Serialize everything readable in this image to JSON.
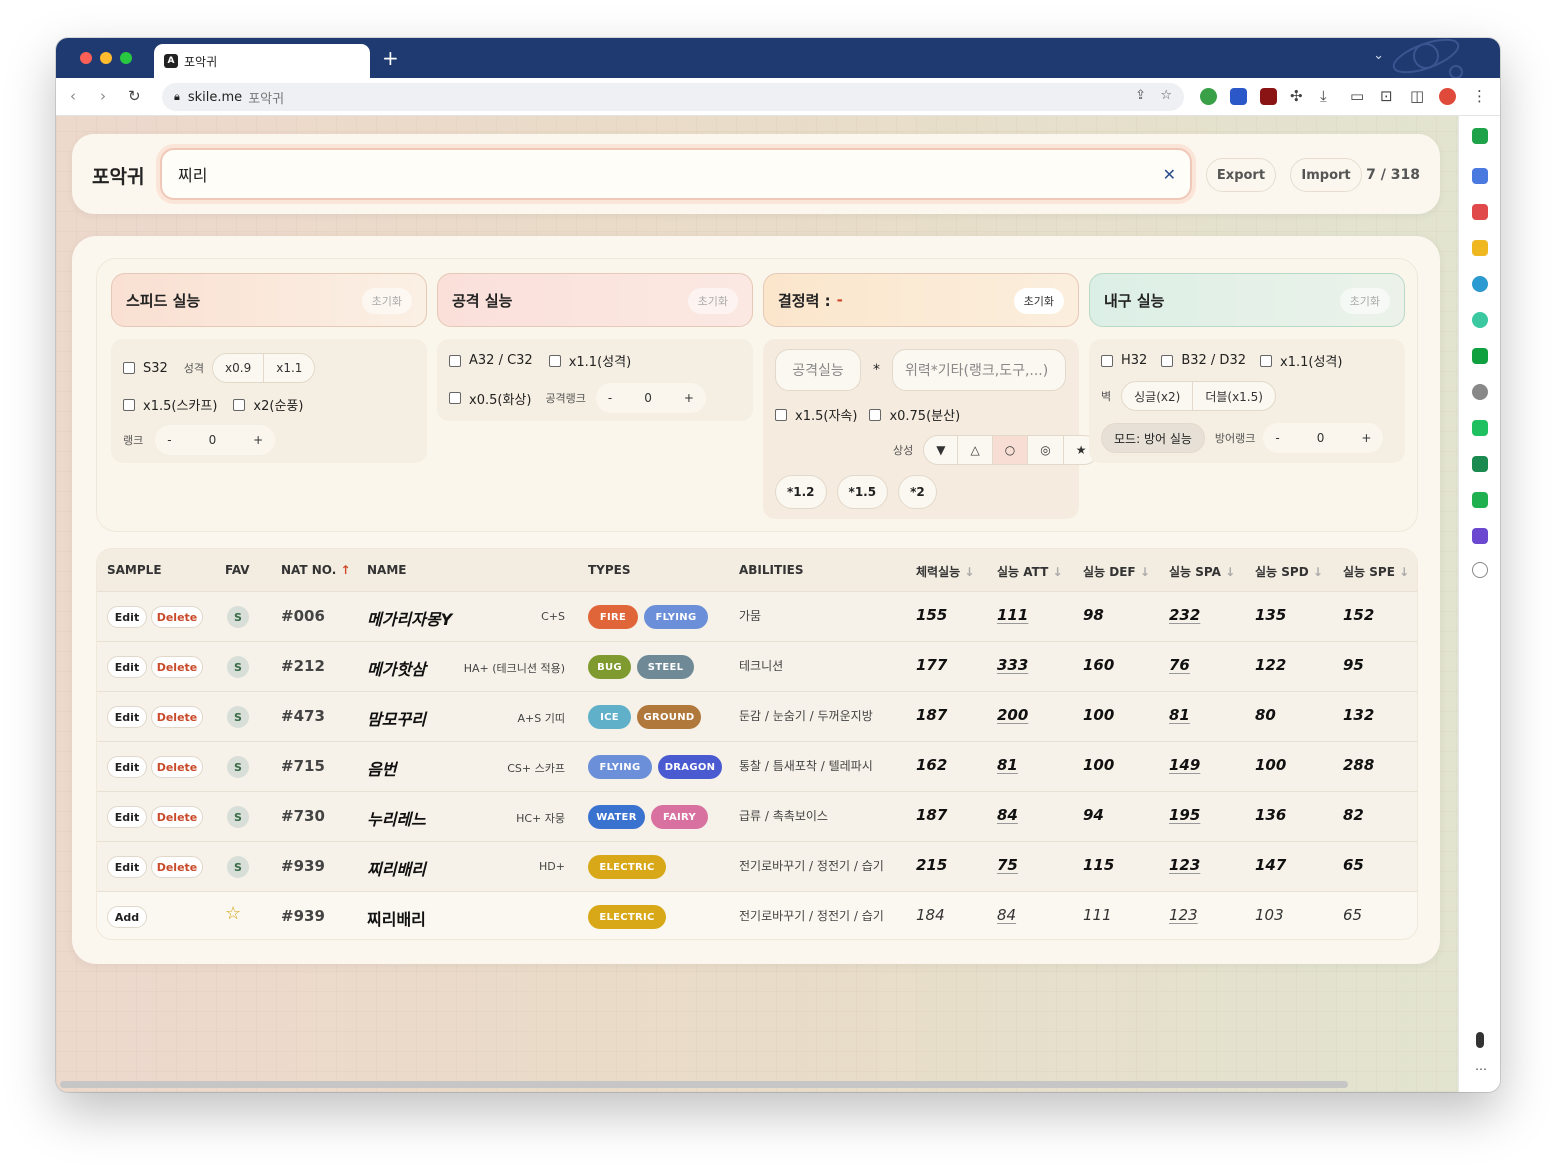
{
  "browser": {
    "tab_title": "포악귀",
    "url_host": "skile.me",
    "url_path": "포악귀"
  },
  "app": {
    "title": "포악귀",
    "search_value": "찌리",
    "export_label": "Export",
    "import_label": "Import",
    "count": "7 / 318"
  },
  "filters": {
    "speed": {
      "title": "스피드 실능",
      "reset": "초기화",
      "s32": "S32",
      "nature_label": "성격",
      "nature_opts": [
        "x0.9",
        "x1.1"
      ],
      "scarf": "x1.5(스카프)",
      "tailwind": "x2(순풍)",
      "rank_label": "랭크",
      "rank_minus": "-",
      "rank_value": "0",
      "rank_plus": "+"
    },
    "attack": {
      "title": "공격 실능",
      "reset": "초기화",
      "a32": "A32 / C32",
      "nature": "x1.1(성격)",
      "burn": "x0.5(화상)",
      "rank_label": "공격랭크",
      "rank_minus": "-",
      "rank_value": "0",
      "rank_plus": "+"
    },
    "decisive": {
      "title": "결정력 :",
      "title_value": "-",
      "reset": "초기화",
      "atk_placeholder": "공격실능",
      "times": "*",
      "power_placeholder": "위력*기타(랭크,도구,...)",
      "stab": "x1.5(자속)",
      "spread": "x0.75(분산)",
      "effect_label": "상성",
      "effect_opts": [
        "▼",
        "△",
        "○",
        "◎",
        "★"
      ],
      "mults": [
        "*1.2",
        "*1.5",
        "*2"
      ]
    },
    "defense": {
      "title": "내구 실능",
      "reset": "초기화",
      "h32": "H32",
      "b32": "B32 / D32",
      "nature": "x1.1(성격)",
      "wall_label": "벽",
      "wall_opts": [
        "싱글(x2)",
        "더블(x1.5)"
      ],
      "mode": "모드: 방어 실능",
      "rank_label": "방어랭크",
      "rank_minus": "-",
      "rank_value": "0",
      "rank_plus": "+"
    }
  },
  "table": {
    "headers": {
      "sample": "SAMPLE",
      "fav": "FAV",
      "natno": "NAT NO.",
      "natno_sort": "↑",
      "name": "NAME",
      "types": "TYPES",
      "abilities": "ABILITIES",
      "hp": "체력실능",
      "att": "실능 ATT",
      "def": "실능 DEF",
      "spa": "실능 SPA",
      "spd": "실능 SPD",
      "spe": "실능 SPE",
      "sort_down": "↓"
    },
    "edit_label": "Edit",
    "delete_label": "Delete",
    "add_label": "Add",
    "sample_badge": "S",
    "fav_star": "☆",
    "rows": [
      {
        "no": "#006",
        "name": "메가리자몽Y",
        "note": "C+S",
        "types": [
          "FIRE",
          "FLYING"
        ],
        "abilities": "가뭄",
        "hp": "155",
        "att": "111",
        "def": "98",
        "spa": "232",
        "spd": "135",
        "spe": "152"
      },
      {
        "no": "#212",
        "name": "메가핫삼",
        "note": "HA+ (테크니션 적용)",
        "types": [
          "BUG",
          "STEEL"
        ],
        "abilities": "테크니션",
        "hp": "177",
        "att": "333",
        "def": "160",
        "spa": "76",
        "spd": "122",
        "spe": "95"
      },
      {
        "no": "#473",
        "name": "맘모꾸리",
        "note": "A+S 기띠",
        "types": [
          "ICE",
          "GROUND"
        ],
        "abilities": "둔감 / 눈숨기 / 두꺼운지방",
        "hp": "187",
        "att": "200",
        "def": "100",
        "spa": "81",
        "spd": "80",
        "spe": "132"
      },
      {
        "no": "#715",
        "name": "음번",
        "note": "CS+ 스카프",
        "types": [
          "FLYING",
          "DRAGON"
        ],
        "abilities": "통찰 / 틈새포착 / 텔레파시",
        "hp": "162",
        "att": "81",
        "def": "100",
        "spa": "149",
        "spd": "100",
        "spe": "288"
      },
      {
        "no": "#730",
        "name": "누리레느",
        "note": "HC+ 자뭉",
        "types": [
          "WATER",
          "FAIRY"
        ],
        "abilities": "급류 / 촉촉보이스",
        "hp": "187",
        "att": "84",
        "def": "94",
        "spa": "195",
        "spd": "136",
        "spe": "82"
      },
      {
        "no": "#939",
        "name": "찌리배리",
        "note": "HD+",
        "types": [
          "ELECTRIC"
        ],
        "abilities": "전기로바꾸기 / 정전기 / 습기",
        "hp": "215",
        "att": "75",
        "def": "115",
        "spa": "123",
        "spd": "147",
        "spe": "65"
      }
    ],
    "add_row": {
      "no": "#939",
      "name": "찌리배리",
      "types": [
        "ELECTRIC"
      ],
      "abilities": "전기로바꾸기 / 정전기 / 습기",
      "hp": "184",
      "att": "84",
      "def": "111",
      "spa": "123",
      "spd": "103",
      "spe": "65"
    }
  },
  "type_colors": {
    "FIRE": "#e0663a",
    "FLYING": "#6b8fd8",
    "BUG": "#7f9a2e",
    "STEEL": "#6f8a96",
    "ICE": "#5fb0c8",
    "GROUND": "#b0783a",
    "DRAGON": "#4a5ad0",
    "WATER": "#3a72d0",
    "FAIRY": "#d870a0",
    "ELECTRIC": "#d8a818"
  },
  "icons": [
    "back-icon",
    "forward-icon",
    "reload-icon",
    "lock-icon",
    "share-icon",
    "bookmark-icon",
    "download-icon",
    "puzzle-icon",
    "close-icon",
    "pin-icon"
  ]
}
